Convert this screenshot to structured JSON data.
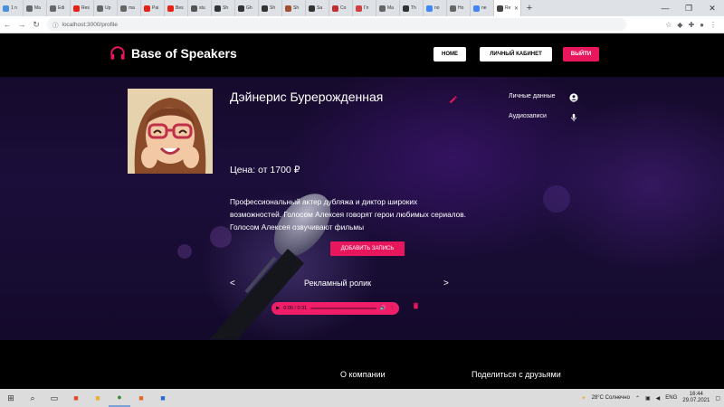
{
  "browser": {
    "tabs": [
      {
        "label": "1 n",
        "color": "#4a90d9"
      },
      {
        "label": "Ma",
        "color": "#666"
      },
      {
        "label": "Edi",
        "color": "#666"
      },
      {
        "label": "Res",
        "color": "#e62117"
      },
      {
        "label": "Up",
        "color": "#666"
      },
      {
        "label": "ma",
        "color": "#666"
      },
      {
        "label": "Pai",
        "color": "#e62117"
      },
      {
        "label": "Bes",
        "color": "#e62117"
      },
      {
        "label": "stu",
        "color": "#555"
      },
      {
        "label": "Sh",
        "color": "#333"
      },
      {
        "label": "Gh",
        "color": "#333"
      },
      {
        "label": "Sh",
        "color": "#333"
      },
      {
        "label": "Sh",
        "color": "#a05030"
      },
      {
        "label": "Sa",
        "color": "#333"
      },
      {
        "label": "Co",
        "color": "#c03030"
      },
      {
        "label": "Гл",
        "color": "#d04040"
      },
      {
        "label": "Ma",
        "color": "#666"
      },
      {
        "label": "Th",
        "color": "#333"
      },
      {
        "label": "no",
        "color": "#4285f4"
      },
      {
        "label": "Ho",
        "color": "#666"
      },
      {
        "label": "ne",
        "color": "#4285f4"
      },
      {
        "label": "Re",
        "color": "#444"
      }
    ],
    "url": "localhost:3000/profile",
    "new_tab": "+",
    "win_minimize": "—",
    "win_restore": "❐",
    "win_close": "✕"
  },
  "header": {
    "logo": "Base of Speakers",
    "nav_home": "HOME",
    "nav_cabinet": "ЛИЧНЫЙ КАБИНЕТ",
    "nav_logout": "ВЫЙТИ",
    "accent": "#e8175d"
  },
  "profile": {
    "name": "Дэйнерис Бурерожденная",
    "price": "Цена: от 1700 ₽",
    "description": "Профессиональный актер дубляжа и диктор широких возможностей. Голосом Алексея говорят герои любимых сериалов. Голосом Алексея озвучивают фильмы",
    "add_record": "ДОБАВИТЬ ЗАПИСЬ"
  },
  "sidebar": {
    "personal": "Личные данные",
    "audio": "Аудиозаписи"
  },
  "player": {
    "prev": "<",
    "next": ">",
    "track_title": "Рекламный ролик",
    "time": "0:00 / 0:31"
  },
  "footer": {
    "about": "О компании",
    "share": "Поделиться с друзьями"
  },
  "taskbar": {
    "weather": "28°C  Солнечно",
    "lang": "ENG",
    "time": "16:44",
    "date": "29.07.2021"
  }
}
